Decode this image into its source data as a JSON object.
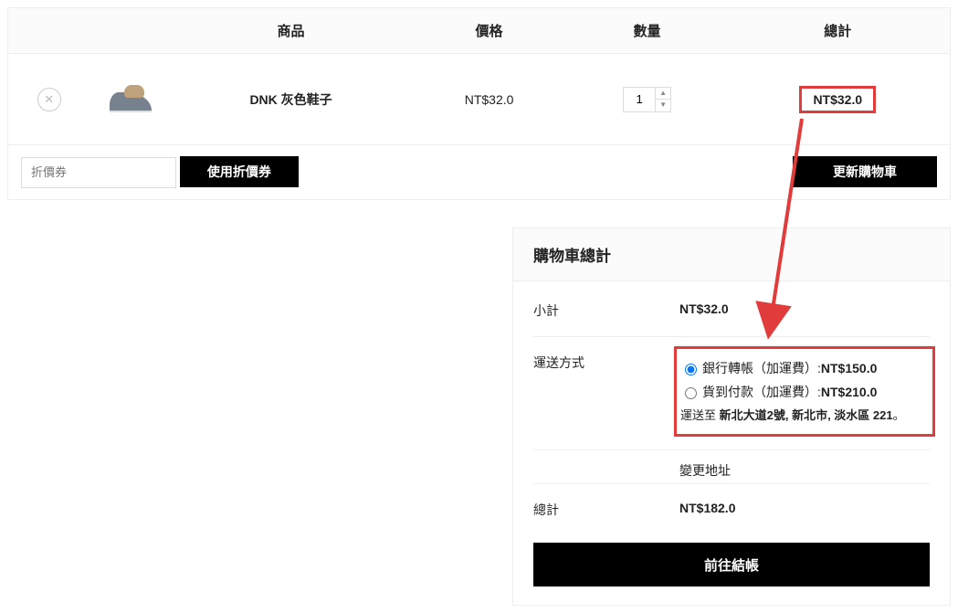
{
  "cart": {
    "headers": {
      "product": "商品",
      "price": "價格",
      "quantity": "數量",
      "subtotal": "總計"
    },
    "items": [
      {
        "name": "DNK 灰色鞋子",
        "price": "NT$32.0",
        "quantity": "1",
        "subtotal": "NT$32.0"
      }
    ],
    "coupon_placeholder": "折價券",
    "apply_coupon_label": "使用折價券",
    "update_cart_label": "更新購物車"
  },
  "totals": {
    "title": "購物車總計",
    "subtotal_label": "小計",
    "subtotal_value": "NT$32.0",
    "shipping_label": "運送方式",
    "shipping_options": [
      {
        "label": "銀行轉帳（加運費）: ",
        "price": "NT$150.0",
        "checked": true
      },
      {
        "label": "貨到付款（加運費）: ",
        "price": "NT$210.0",
        "checked": false
      }
    ],
    "ship_to_prefix": "運送至 ",
    "ship_to_address": "新北大道2號, 新北市, 淡水區 221",
    "ship_to_suffix": "。",
    "change_address_label": "變更地址",
    "total_label": "總計",
    "total_value": "NT$182.0",
    "checkout_label": "前往結帳"
  }
}
